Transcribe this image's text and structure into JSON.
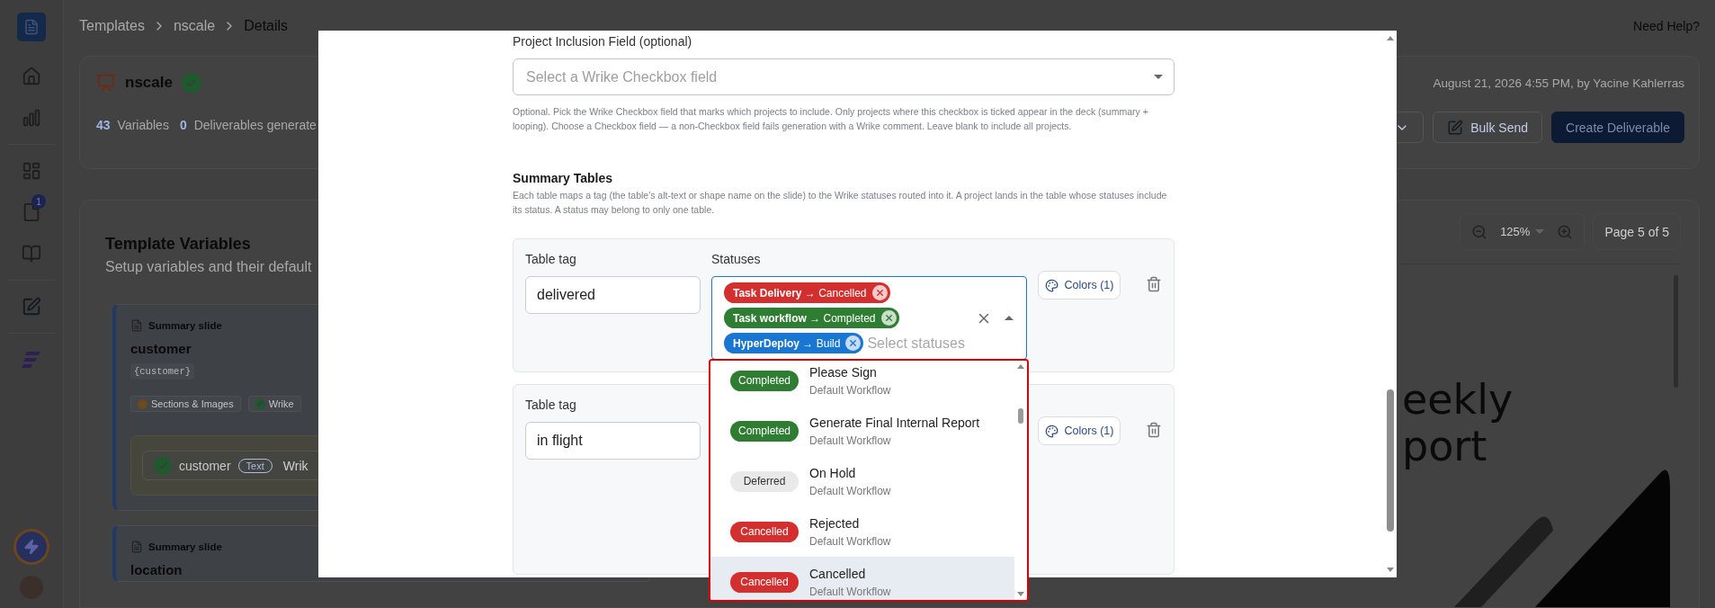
{
  "sidebar": {
    "badge": "1"
  },
  "breadcrumb": [
    {
      "label": "Templates",
      "current": false
    },
    {
      "label": "nscale",
      "current": false
    },
    {
      "label": "Details",
      "current": true
    }
  ],
  "help": "Need Help?",
  "template": {
    "name": "nscale",
    "verified": true,
    "stats": [
      {
        "count": "43",
        "label": "Variables"
      },
      {
        "count": "0",
        "label": "Deliverables generate"
      }
    ],
    "updated": "August 21, 2026 4:55 PM, by Yacine Kahlerras",
    "actions": [
      {
        "kind": "menu"
      },
      {
        "kind": "outline",
        "label": "Bulk Send"
      },
      {
        "kind": "primary",
        "label": "Create Deliverable"
      }
    ]
  },
  "variables": {
    "title": "Template Variables",
    "subtitle": "Setup variables and their default",
    "cards": [
      {
        "section": "Summary slide",
        "name": "customer",
        "token": "{customer}",
        "tags": [
          {
            "kind": "sections",
            "label": "Sections & Images"
          },
          {
            "kind": "wrike",
            "label": "Wrike"
          }
        ],
        "mapping": {
          "name": "customer",
          "type": "Text",
          "source": "Wrik",
          "mapped": true
        }
      },
      {
        "section": "Summary slide",
        "name": "location"
      }
    ]
  },
  "preview": {
    "zoom": "125%",
    "page": "Page 5 of 5",
    "slide_title": [
      "eekly",
      "port"
    ]
  },
  "modal": {
    "inclusion_field": {
      "label": "Project Inclusion Field (optional)",
      "placeholder": "Select a Wrike Checkbox field",
      "help": "Optional. Pick the Wrike Checkbox field that marks which projects to include. Only projects where this checkbox is ticked appear in the deck (summary + looping). Choose a Checkbox field — a non-Checkbox field fails generation with a Wrike comment. Leave blank to include all projects."
    },
    "summary_tables": {
      "title": "Summary Tables",
      "description": "Each table maps a tag (the table's alt-text or shape name on the slide) to the Wrike statuses routed into it. A project lands in the table whose statuses include its status. A status may belong to only one table.",
      "tables": [
        {
          "tag_label": "Table tag",
          "tag": "delivered",
          "statuses_label": "Statuses",
          "open": true,
          "placeholder": "Select statuses",
          "colors_button": "Colors (1)",
          "statuses": [
            {
              "label": "**Task Delivery** → Cancelled",
              "color": "#d32f2f"
            },
            {
              "label": "**Task workflow** → Completed",
              "color": "#2e7d32"
            },
            {
              "label": "**HyperDeploy** → Build",
              "color": "#1976d2"
            }
          ]
        },
        {
          "tag_label": "Table tag",
          "tag": "in flight",
          "colors_button": "Colors (1)"
        }
      ]
    },
    "dropdown": {
      "options": [
        {
          "badge": "Completed",
          "color": "#2e7d32",
          "name": "Please Sign",
          "workflow": "Default Workflow",
          "highlighted": false
        },
        {
          "badge": "Completed",
          "color": "#2e7d32",
          "name": "Generate Final Internal Report",
          "workflow": "Default Workflow",
          "highlighted": false
        },
        {
          "badge": "Deferred",
          "color": "#e9e9e9",
          "name": "On Hold",
          "workflow": "Default Workflow",
          "highlighted": false
        },
        {
          "badge": "Cancelled",
          "color": "#d32f2f",
          "name": "Rejected",
          "workflow": "Default Workflow",
          "highlighted": false
        },
        {
          "badge": "Cancelled",
          "color": "#d32f2f",
          "name": "Cancelled",
          "workflow": "Default Workflow",
          "highlighted": true
        }
      ]
    }
  }
}
